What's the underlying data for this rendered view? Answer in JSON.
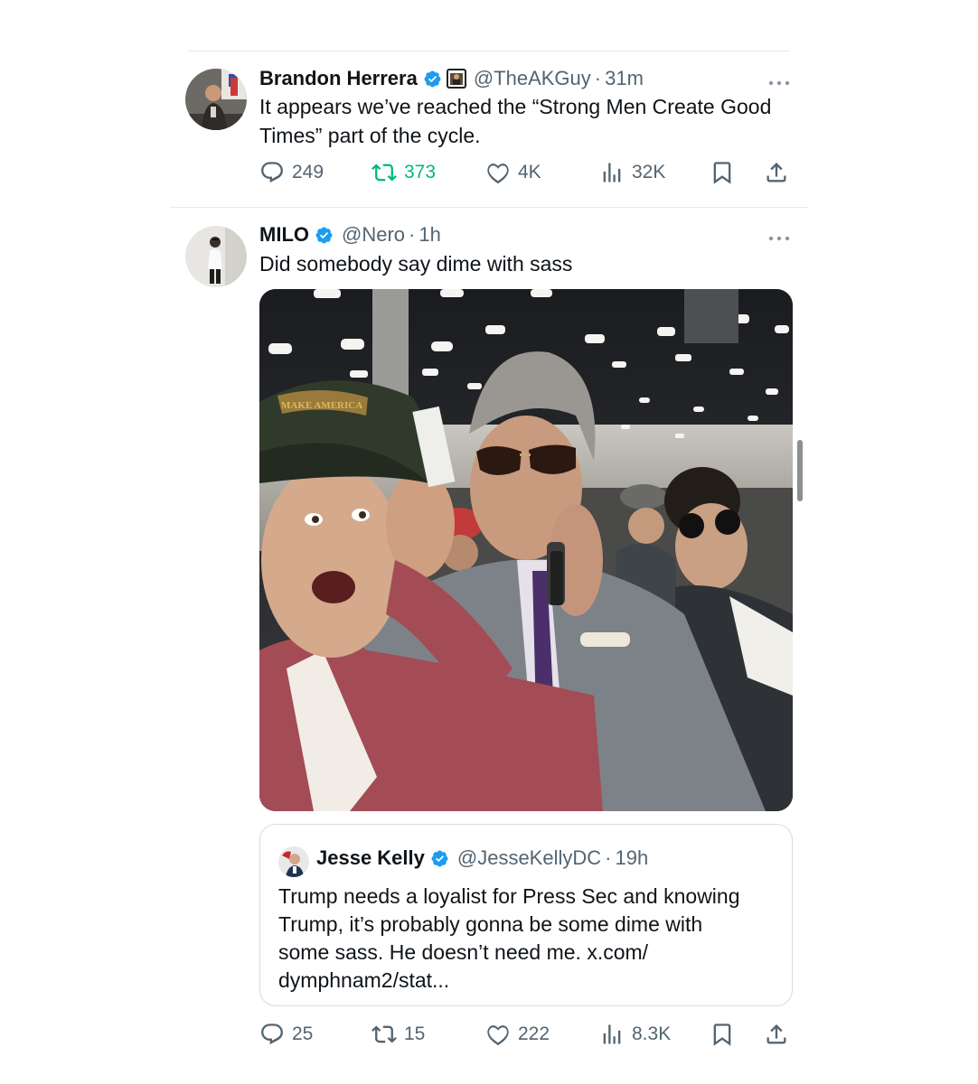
{
  "tweets": [
    {
      "name": "Brandon Herrera",
      "handle": "@TheAKGuy",
      "separator": "·",
      "time": "31m",
      "text_line1": "It appears we’ve reached the “Strong Men Create Good",
      "text_line2": "Times” part of the cycle.",
      "replies": "249",
      "retweets": "373",
      "likes": "4K",
      "views": "32K"
    },
    {
      "name": "MILO",
      "handle": "@Nero",
      "separator": "·",
      "time": "1h",
      "text": "Did somebody say dime with sass",
      "photo_cap_text": "MAKE AMERICA GREAT AGAIN",
      "replies": "25",
      "retweets": "15",
      "likes": "222",
      "views": "8.3K"
    }
  ],
  "quote": {
    "name": "Jesse Kelly",
    "handle": "@JesseKellyDC",
    "separator": "·",
    "time": "19h",
    "line1": "Trump needs a loyalist for Press Sec and knowing",
    "line2": "Trump, it’s probably gonna be some dime with",
    "line3": "some sass. He doesn’t need me. x.com/",
    "line4": "dymphnam2/stat..."
  },
  "colors": {
    "verified": "#1d9bf0",
    "retweet_active": "#00ba7c",
    "muted": "#536471"
  },
  "icons": [
    "reply-icon",
    "retweet-icon",
    "like-icon",
    "views-icon",
    "bookmark-icon",
    "share-icon",
    "more-icon",
    "verified-icon",
    "affiliate-badge-icon"
  ]
}
